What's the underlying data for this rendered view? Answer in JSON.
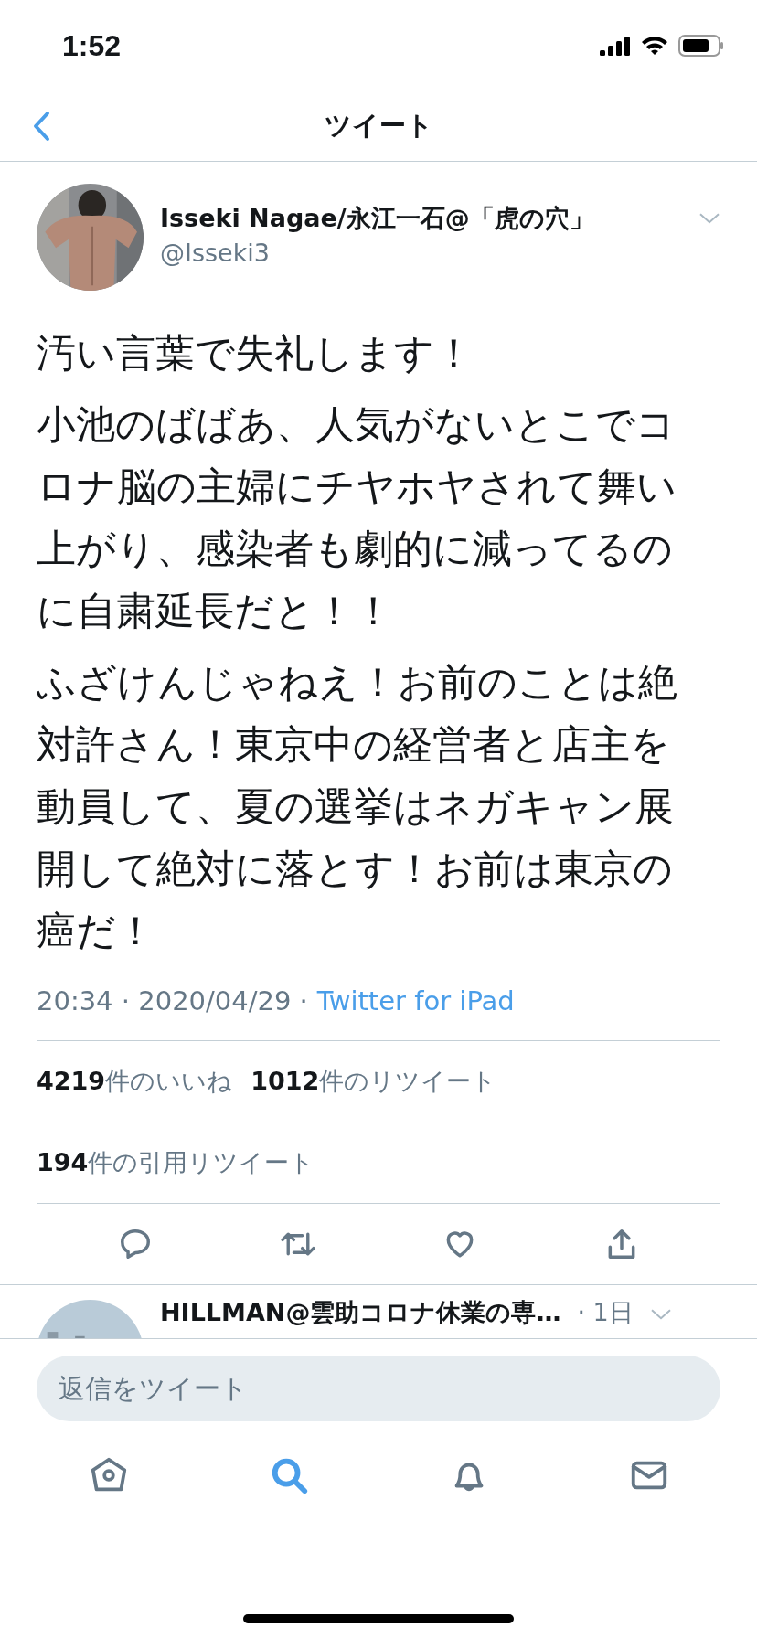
{
  "status_bar": {
    "time": "1:52"
  },
  "header": {
    "title": "ツイート"
  },
  "tweet": {
    "author": {
      "name": "Isseki Nagae/永江一石@「虎の穴」",
      "handle": "@Isseki3"
    },
    "paragraphs": [
      "汚い言葉で失礼します！",
      "小池のばばあ、人気がないとこでコロナ脳の主婦にチヤホヤされて舞い上がり、感染者も劇的に減ってるのに自粛延長だと！！",
      "ふざけんじゃねえ！お前のことは絶対許さん！東京中の経営者と店主を動員して、夏の選挙はネガキャン展開して絶対に落とす！お前は東京の癌だ！"
    ],
    "timestamp": "20:34 · 2020/04/29 ·",
    "source": "Twitter for iPad",
    "stats": [
      [
        {
          "count": "4219",
          "label": "件のいいね"
        },
        {
          "count": "1012",
          "label": "件のリツイート"
        }
      ],
      [
        {
          "count": "194",
          "label": "件の引用リツイート"
        }
      ]
    ],
    "actions": [
      {
        "kind": "reply"
      },
      {
        "kind": "retweet"
      },
      {
        "kind": "like"
      },
      {
        "kind": "share"
      }
    ]
  },
  "replies": [
    {
      "name": "HILLMAN@雲助コロナ休業の専…",
      "age": "· 1日"
    }
  ],
  "reply_field": {
    "placeholder": "返信をツイート"
  },
  "tab_bar": [
    {
      "kind": "home",
      "selected": false
    },
    {
      "kind": "search",
      "selected": true
    },
    {
      "kind": "notifications",
      "selected": false
    },
    {
      "kind": "messages",
      "selected": false
    }
  ]
}
